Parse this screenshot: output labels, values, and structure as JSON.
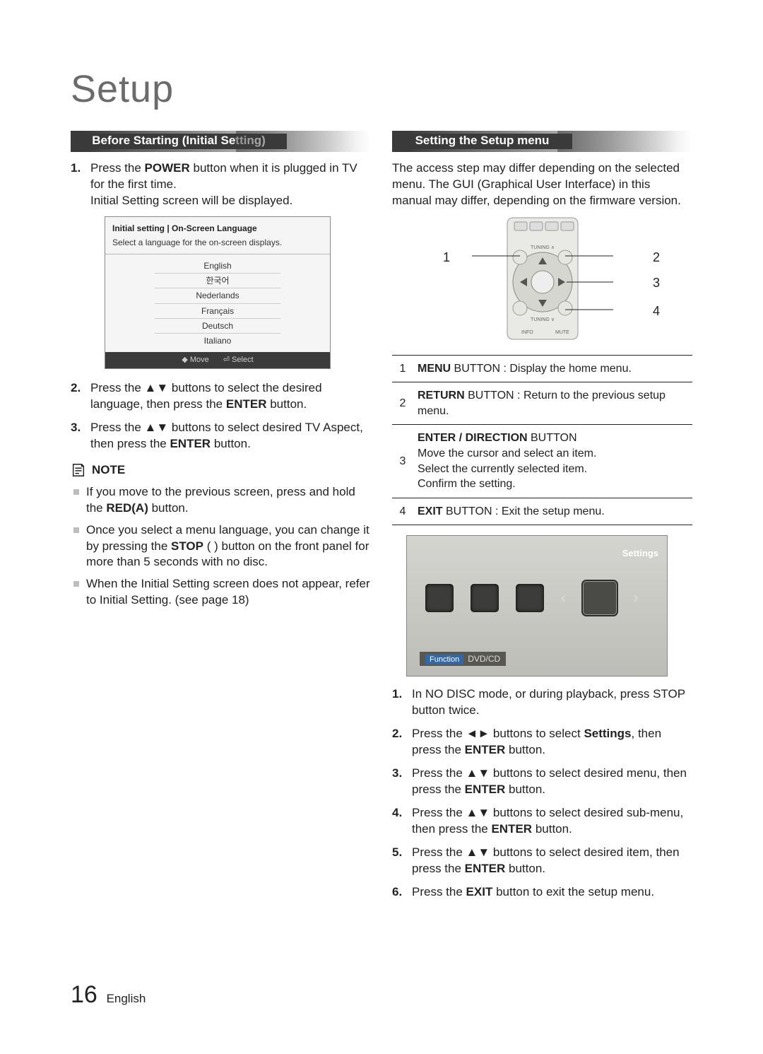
{
  "page_title": "Setup",
  "page_number": "16",
  "page_lang": "English",
  "left": {
    "header": "Before Starting (Initial Setting)",
    "steps": [
      {
        "pre": "Press the ",
        "b1": "POWER",
        "post": " button when it is plugged in TV for the first time.\nInitial Setting screen will be displayed."
      },
      {
        "pre": "Press the ▲▼ buttons to select the desired language, then press the ",
        "b1": "ENTER",
        "post": " button."
      },
      {
        "pre": "Press the ▲▼ buttons to select desired TV Aspect, then press the ",
        "b1": "ENTER",
        "post": " button."
      }
    ],
    "langbox": {
      "title": "Initial setting | On-Screen Language",
      "subtitle": "Select a language for the on-screen displays.",
      "items": [
        "English",
        "한국어",
        "Nederlands",
        "Français",
        "Deutsch",
        "Italiano"
      ],
      "move": "◆ Move",
      "select": "⏎ Select"
    },
    "note_label": "NOTE",
    "notes": [
      {
        "pre": "If you move to the previous screen, press and hold the ",
        "b1": "RED(A)",
        "post": " button."
      },
      {
        "pre": "Once you select a menu language, you can change it by pressing the ",
        "b1": "STOP",
        "mid": " (  ) button on the front panel for more than 5 seconds with no disc.",
        "post": ""
      },
      {
        "pre": "When the Initial Setting screen does not appear, refer to Initial Setting. (see page 18)",
        "b1": "",
        "post": ""
      }
    ]
  },
  "right": {
    "header": "Setting the Setup menu",
    "intro": "The access step may differ depending on the selected menu. The GUI (Graphical User Interface) in this manual may differ, depending on the firmware version.",
    "callouts": [
      "1",
      "2",
      "3",
      "4"
    ],
    "table": [
      {
        "n": "1",
        "b": "MENU",
        "s": " BUTTON : Display the home menu."
      },
      {
        "n": "2",
        "b": "RETURN",
        "s": " BUTTON : Return to the previous setup menu."
      },
      {
        "n": "3",
        "b": "ENTER / DIRECTION",
        "s": " BUTTON\nMove the cursor and select an item.\nSelect the currently selected item.\nConfirm the setting."
      },
      {
        "n": "4",
        "b": "EXIT",
        "s": " BUTTON : Exit the setup menu."
      }
    ],
    "tv": {
      "badge": "Settings",
      "fn": "Function",
      "mode": "DVD/CD"
    },
    "steps": [
      {
        "text": "In NO DISC mode, or during playback, press STOP button twice."
      },
      {
        "text": "Press the ◄► buttons to select ",
        "b1": "Settings",
        "mid": ", then press the ",
        "b2": "ENTER",
        "post": " button."
      },
      {
        "text": "Press the ▲▼ buttons to select desired menu, then press the ",
        "b1": "ENTER",
        "post": " button."
      },
      {
        "text": "Press the ▲▼ buttons to select desired sub-menu, then press the ",
        "b1": "ENTER",
        "post": " button."
      },
      {
        "text": "Press the ▲▼ buttons to select desired item, then press the ",
        "b1": "ENTER",
        "post": " button."
      },
      {
        "text": "Press the ",
        "b1": "EXIT",
        "post": " button to exit the setup menu."
      }
    ]
  }
}
